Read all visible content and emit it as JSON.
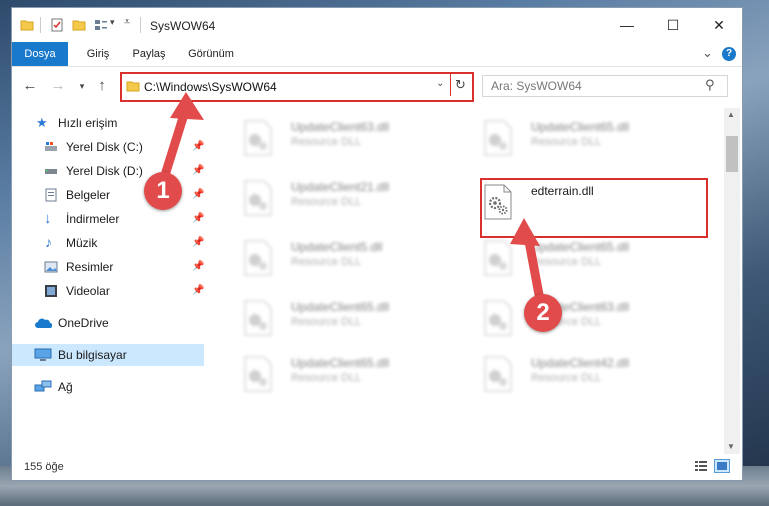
{
  "window": {
    "title": "SysWOW64",
    "controls": {
      "minimize": "—",
      "maximize": "☐",
      "close": "✕"
    }
  },
  "ribbon": {
    "tabs": [
      "Dosya",
      "Giriş",
      "Paylaş",
      "Görünüm"
    ],
    "expand": "⌄",
    "help": "?"
  },
  "address": {
    "path": "C:\\Windows\\SysWOW64",
    "search_placeholder": "Ara: SysWOW64"
  },
  "sidebar": {
    "quick_access": "Hızlı erişim",
    "items": [
      {
        "label": "Yerel Disk (C:)",
        "icon": "drive-icon"
      },
      {
        "label": "Yerel Disk (D:)",
        "icon": "drive-icon"
      },
      {
        "label": "Belgeler",
        "icon": "documents-icon"
      },
      {
        "label": "İndirmeler",
        "icon": "download-icon"
      },
      {
        "label": "Müzik",
        "icon": "music-icon"
      },
      {
        "label": "Resimler",
        "icon": "pictures-icon"
      },
      {
        "label": "Videolar",
        "icon": "video-icon"
      }
    ],
    "onedrive": "OneDrive",
    "this_pc": "Bu bilgisayar",
    "network": "Ağ"
  },
  "files": {
    "left": [
      {
        "name": "UpdateClient63.dll",
        "type": "Resource DLL"
      },
      {
        "name": "UpdateClient21.dll",
        "type": "Resource DLL"
      },
      {
        "name": "UpdateClient5.dll",
        "type": "Resource DLL"
      },
      {
        "name": "UpdateClient65.dll",
        "type": "Resource DLL"
      },
      {
        "name": "UpdateClient65.dll",
        "type": "Resource DLL"
      }
    ],
    "right": [
      {
        "name": "UpdateClient65.dll",
        "type": "Resource DLL"
      },
      {
        "name": "edterrain.dll",
        "type": ""
      },
      {
        "name": "UpdateClient65.dll",
        "type": "Resource DLL"
      },
      {
        "name": "UpdateClient63.dll",
        "type": "Resource DLL"
      },
      {
        "name": "UpdateClient42.dll",
        "type": "Resource DLL"
      }
    ]
  },
  "status": {
    "count": "155 öğe"
  },
  "annotations": {
    "step1": "1",
    "step2": "2"
  },
  "colors": {
    "accent": "#1979ca",
    "highlight": "#d9302c",
    "annotation": "#e14b4b"
  }
}
